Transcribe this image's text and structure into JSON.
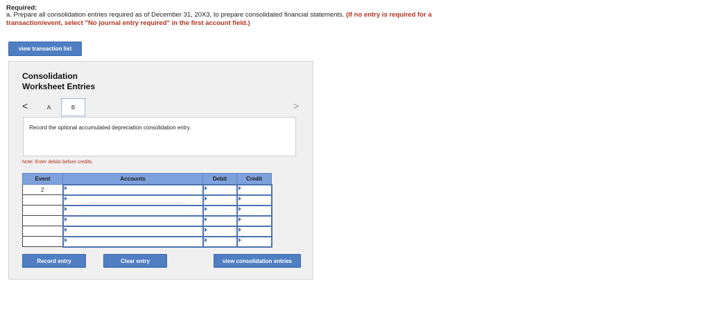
{
  "header": {
    "required_label": "Required:",
    "instruction_text": "a. Prepare all consolidation entries required as of December 31, 20X3, to prepare consolidated financial statements.",
    "instruction_red": "(If no entry is required for a transaction/event, select \"No journal entry required\" in the first account field.)"
  },
  "buttons": {
    "view_transaction_list": "view transaction list",
    "record_entry": "Record entry",
    "clear_entry": "Clear entry",
    "view_consolidation_entries": "view consolidation entries"
  },
  "panel": {
    "title_line1": "Consolidation",
    "title_line2": "Worksheet Entries",
    "nav_prev": "<",
    "nav_next": ">",
    "tabs": [
      "A",
      "B"
    ],
    "active_tab": "B",
    "description": "Record the optional accumulated depreciation consolidation entry.",
    "note": "Note: Enter debits before credits."
  },
  "table": {
    "columns": [
      "Event",
      "Accounts",
      "Debit",
      "Credit"
    ],
    "rows": [
      {
        "event": "2",
        "account": "",
        "debit": "",
        "credit": ""
      },
      {
        "event": "",
        "account": "",
        "debit": "",
        "credit": ""
      },
      {
        "event": "",
        "account": "",
        "debit": "",
        "credit": ""
      },
      {
        "event": "",
        "account": "",
        "debit": "",
        "credit": ""
      },
      {
        "event": "",
        "account": "",
        "debit": "",
        "credit": ""
      },
      {
        "event": "",
        "account": "",
        "debit": "",
        "credit": ""
      }
    ]
  },
  "colors": {
    "button_blue": "#4f7fc2",
    "header_blue": "#7da1dc",
    "note_red": "#b5321f"
  }
}
